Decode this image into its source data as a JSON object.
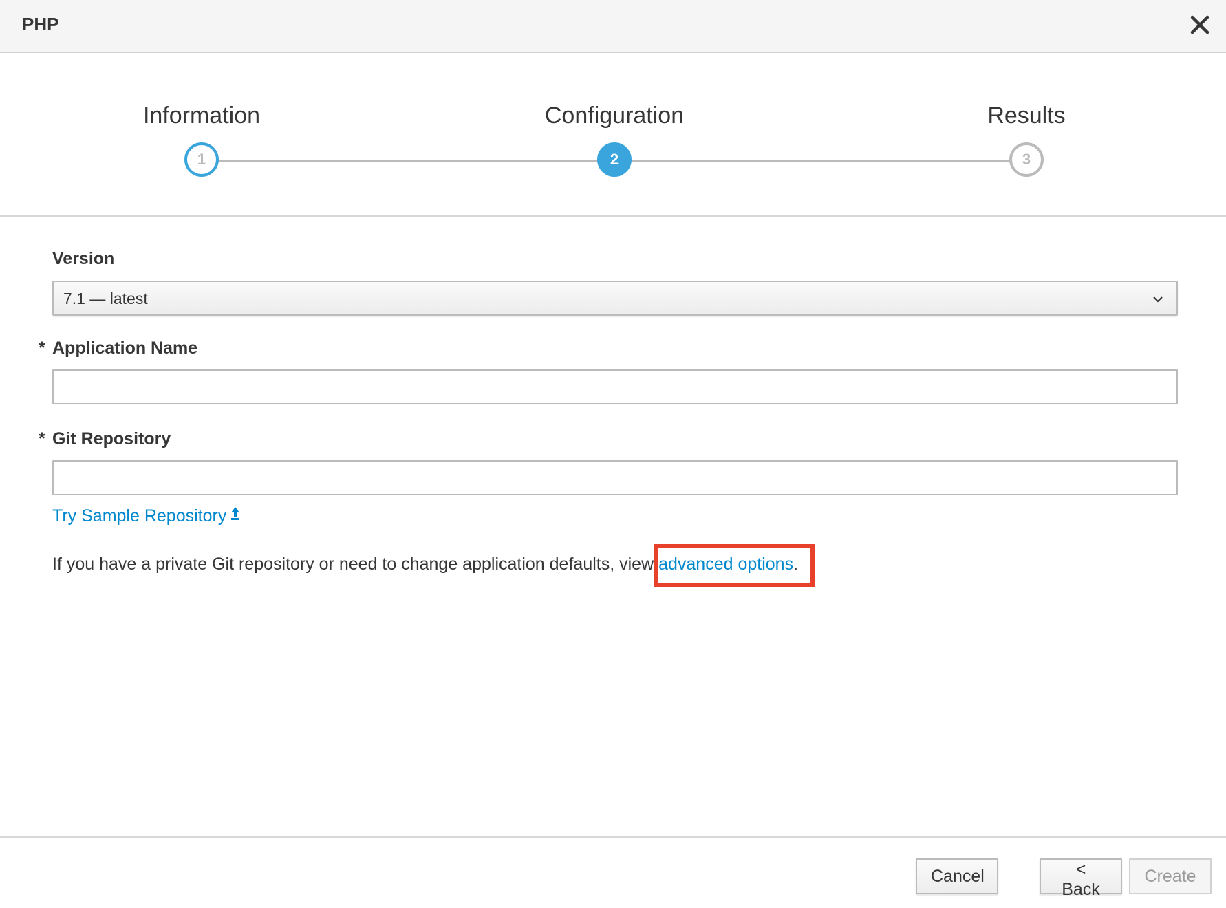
{
  "dialog": {
    "title": "PHP",
    "close_icon": "close-icon"
  },
  "wizard": {
    "steps": [
      {
        "label": "Information",
        "number": "1",
        "state": "done"
      },
      {
        "label": "Configuration",
        "number": "2",
        "state": "active"
      },
      {
        "label": "Results",
        "number": "3",
        "state": "todo"
      }
    ]
  },
  "form": {
    "version": {
      "label": "Version",
      "selected": "7.1 — latest"
    },
    "app_name": {
      "required_mark": "*",
      "label": "Application Name",
      "value": ""
    },
    "git_repo": {
      "required_mark": "*",
      "label": "Git Repository",
      "value": ""
    },
    "sample_link": "Try Sample Repository",
    "help_text_prefix": "If you have a private Git repository or need to change application defaults, view ",
    "advanced_link": "advanced options",
    "help_text_suffix": "."
  },
  "footer": {
    "cancel": "Cancel",
    "back": "< Back",
    "create": "Create"
  },
  "colors": {
    "accent": "#39a5dc",
    "link": "#0088ce",
    "highlight": "#e8412b"
  }
}
